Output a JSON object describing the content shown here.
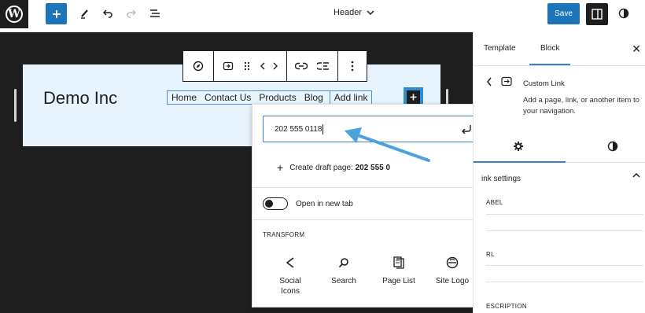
{
  "topbar": {
    "wp_logo_icon": "wordpress-logo",
    "add_icon": "plus-icon",
    "tools": [
      "pencil-icon",
      "undo-icon",
      "redo-icon",
      "list-view-icon"
    ],
    "document_title": "Header",
    "save_label": "Save",
    "settings_icon": "sidebar-toggle-icon",
    "styles_icon": "half-circle-icon"
  },
  "canvas": {
    "site_title": "Demo Inc",
    "nav_items": [
      "Home",
      "Contact Us",
      "Products",
      "Blog"
    ],
    "nav_active_item": "Add link",
    "block_toolbar_icons": [
      "compass-icon",
      "link-block-icon",
      "drag-icon",
      "arrows-icon",
      "link-icon",
      "unlink-icon",
      "more-icon"
    ]
  },
  "link_popover": {
    "input_value": "202 555 0118",
    "draft_prefix": "Create draft page: ",
    "draft_value": "202 555 0",
    "open_new_tab": "Open in new tab",
    "transform_heading": "TRANSFORM",
    "transform_options": [
      {
        "label": "Social Icons",
        "icon": "share-icon"
      },
      {
        "label": "Search",
        "icon": "search-icon"
      },
      {
        "label": "Page List",
        "icon": "page-list-icon"
      },
      {
        "label": "Site Logo",
        "icon": "site-logo-icon"
      }
    ]
  },
  "sidebar": {
    "tabs": [
      "Template",
      "Block"
    ],
    "active_tab": "Block",
    "block_name": "Custom Link",
    "block_description": "Add a page, link, or another item to your navigation.",
    "section_title": "ink settings",
    "fields": [
      "ABEL",
      "RL",
      "ESCRIPTION"
    ]
  },
  "colors": {
    "accent": "#1d74b9",
    "canvas_bg": "#1e1e1e",
    "header_bg": "#e8f4fd",
    "arrow": "#4aa3df"
  }
}
